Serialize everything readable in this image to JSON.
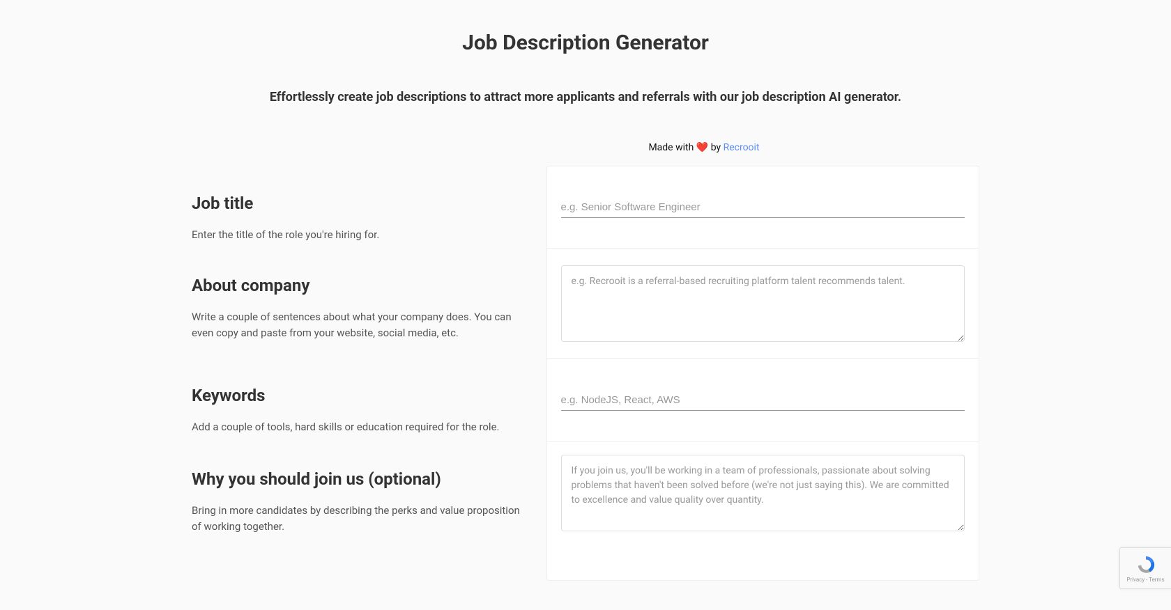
{
  "header": {
    "title": "Job Description Generator",
    "subtitle": "Effortlessly create job descriptions to attract more applicants and referrals with our job description AI generator.",
    "made_with_prefix": "Made with ",
    "made_with_by": " by ",
    "brand": "Recrooit"
  },
  "sections": [
    {
      "label": "Job title",
      "help": "Enter the title of the role you're hiring for.",
      "type": "text",
      "placeholder": "e.g. Senior Software Engineer"
    },
    {
      "label": "About company",
      "help": "Write a couple of sentences about what your company does. You can even copy and paste from your website, social media, etc.",
      "type": "textarea",
      "placeholder": "e.g. Recrooit is a referral-based recruiting platform talent recommends talent."
    },
    {
      "label": "Keywords",
      "help": "Add a couple of tools, hard skills or education required for the role.",
      "type": "text",
      "placeholder": "e.g. NodeJS, React, AWS"
    },
    {
      "label": "Why you should join us (optional)",
      "help": "Bring in more candidates by describing the perks and value proposition of working together.",
      "type": "textarea",
      "placeholder": "If you join us, you'll be working in a team of professionals, passionate about solving problems that haven't been solved before (we're not just saying this). We are committed to excellence and value quality over quantity."
    }
  ],
  "recaptcha": {
    "line": "Privacy - Terms"
  }
}
